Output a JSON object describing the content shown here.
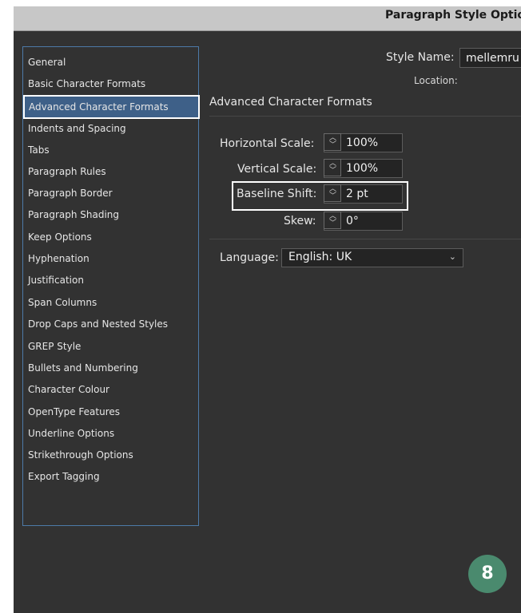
{
  "window": {
    "title": "Paragraph Style Optio"
  },
  "sidebar": {
    "items": [
      {
        "label": "General"
      },
      {
        "label": "Basic Character Formats"
      },
      {
        "label": "Advanced Character Formats",
        "selected": true
      },
      {
        "label": "Indents and Spacing"
      },
      {
        "label": "Tabs"
      },
      {
        "label": "Paragraph Rules"
      },
      {
        "label": "Paragraph Border"
      },
      {
        "label": "Paragraph Shading"
      },
      {
        "label": "Keep Options"
      },
      {
        "label": "Hyphenation"
      },
      {
        "label": "Justification"
      },
      {
        "label": "Span Columns"
      },
      {
        "label": "Drop Caps and Nested Styles"
      },
      {
        "label": "GREP Style"
      },
      {
        "label": "Bullets and Numbering"
      },
      {
        "label": "Character Colour"
      },
      {
        "label": "OpenType Features"
      },
      {
        "label": "Underline Options"
      },
      {
        "label": "Strikethrough Options"
      },
      {
        "label": "Export Tagging"
      }
    ]
  },
  "header": {
    "style_name_label": "Style Name:",
    "style_name_value": "mellemru",
    "location_label": "Location:"
  },
  "section": {
    "title": "Advanced Character Formats"
  },
  "fields": {
    "horizontal_scale": {
      "label": "Horizontal Scale:",
      "value": "100%"
    },
    "vertical_scale": {
      "label": "Vertical Scale:",
      "value": "100%"
    },
    "baseline_shift": {
      "label": "Baseline Shift:",
      "value": "2 pt"
    },
    "skew": {
      "label": "Skew:",
      "value": "0°"
    }
  },
  "language": {
    "label": "Language:",
    "value": "English: UK"
  },
  "badge": {
    "text": "8"
  },
  "colors": {
    "panel_bg": "#323232",
    "titlebar_bg": "#c7c7c7",
    "selection_bg": "#3e6088",
    "sidebar_border": "#4d7aa8",
    "badge_bg": "#4a8a6e"
  }
}
